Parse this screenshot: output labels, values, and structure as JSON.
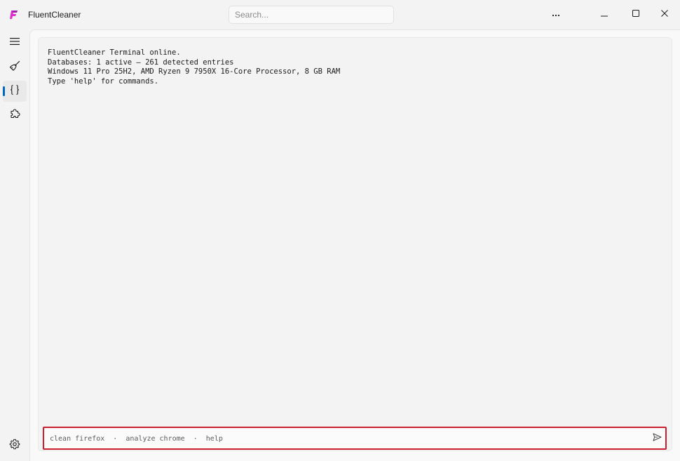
{
  "app": {
    "title": "FluentCleaner",
    "icon": "fluentcleaner-logo-icon",
    "brand_color": "#e02fd0"
  },
  "search": {
    "placeholder": "Search..."
  },
  "window_controls": {
    "more": "more-options-icon",
    "minimize": "minimize-icon",
    "maximize": "maximize-icon",
    "close": "close-icon"
  },
  "sidebar": {
    "items": [
      {
        "name": "menu",
        "icon": "hamburger-menu-icon"
      },
      {
        "name": "clean",
        "icon": "broom-icon"
      },
      {
        "name": "terminal",
        "icon": "curly-braces-icon",
        "selected": true
      },
      {
        "name": "plugins",
        "icon": "puzzle-icon"
      }
    ],
    "footer": {
      "name": "settings",
      "icon": "gear-icon"
    },
    "accent": "#0067c0"
  },
  "terminal": {
    "lines": [
      "FluentCleaner Terminal online.",
      "Databases: 1 active – 261 detected entries",
      "Windows 11 Pro 25H2, AMD Ryzen 9 7950X 16-Core Processor, 8 GB RAM",
      "Type 'help' for commands."
    ],
    "command_placeholder": "clean firefox  ·  analyze chrome  ·  help",
    "send_icon": "send-icon",
    "highlight_color": "#cc1f2e"
  }
}
